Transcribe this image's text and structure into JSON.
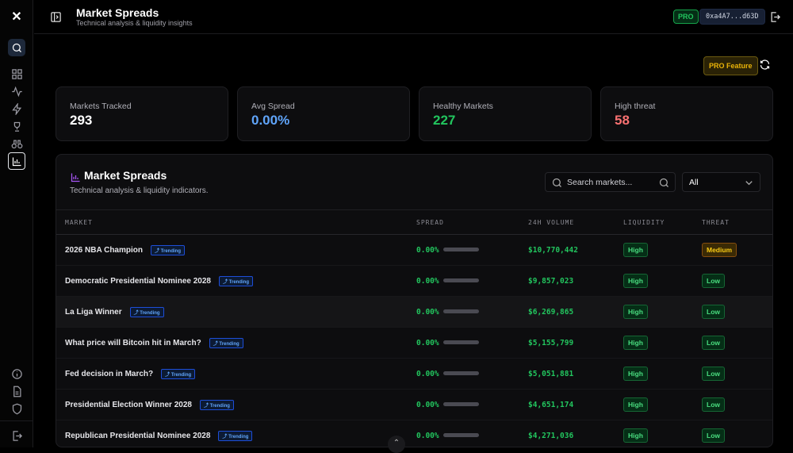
{
  "header": {
    "title": "Market Spreads",
    "subtitle": "Technical analysis & liquidity insights",
    "pro_badge": "PRO",
    "wallet": "0xa4A7...d63D"
  },
  "toolbar": {
    "pro_feature": "PRO Feature"
  },
  "stats": [
    {
      "label": "Markets Tracked",
      "value": "293",
      "color": "#ffffff"
    },
    {
      "label": "Avg Spread",
      "value": "0.00%",
      "color": "#60a5fa"
    },
    {
      "label": "Healthy Markets",
      "value": "227",
      "color": "#22c55e"
    },
    {
      "label": "High threat",
      "value": "58",
      "color": "#f87171"
    }
  ],
  "panel": {
    "title": "Market Spreads",
    "subtitle": "Technical analysis & liquidity indicators.",
    "search_placeholder": "Search markets...",
    "filter": "All"
  },
  "table": {
    "headers": [
      "MARKET",
      "SPREAD",
      "24H VOLUME",
      "LIQUIDITY",
      "THREAT"
    ],
    "rows": [
      {
        "market": "2026 NBA Champion",
        "tag": "Trending",
        "spread": "0.00%",
        "volume": "$10,770,442",
        "liquidity": "High",
        "threat": "Medium"
      },
      {
        "market": "Democratic Presidential Nominee 2028",
        "tag": "Trending",
        "spread": "0.00%",
        "volume": "$9,857,023",
        "liquidity": "High",
        "threat": "Low"
      },
      {
        "market": "La Liga Winner",
        "tag": "Trending",
        "spread": "0.00%",
        "volume": "$6,269,865",
        "liquidity": "High",
        "threat": "Low"
      },
      {
        "market": "What price will Bitcoin hit in March?",
        "tag": "Trending",
        "spread": "0.00%",
        "volume": "$5,155,799",
        "liquidity": "High",
        "threat": "Low"
      },
      {
        "market": "Fed decision in March?",
        "tag": "Trending",
        "spread": "0.00%",
        "volume": "$5,051,881",
        "liquidity": "High",
        "threat": "Low"
      },
      {
        "market": "Presidential Election Winner 2028",
        "tag": "Trending",
        "spread": "0.00%",
        "volume": "$4,651,174",
        "liquidity": "High",
        "threat": "Low"
      },
      {
        "market": "Republican Presidential Nominee 2028",
        "tag": "Trending",
        "spread": "0.00%",
        "volume": "$4,271,036",
        "liquidity": "High",
        "threat": "Low"
      }
    ]
  }
}
